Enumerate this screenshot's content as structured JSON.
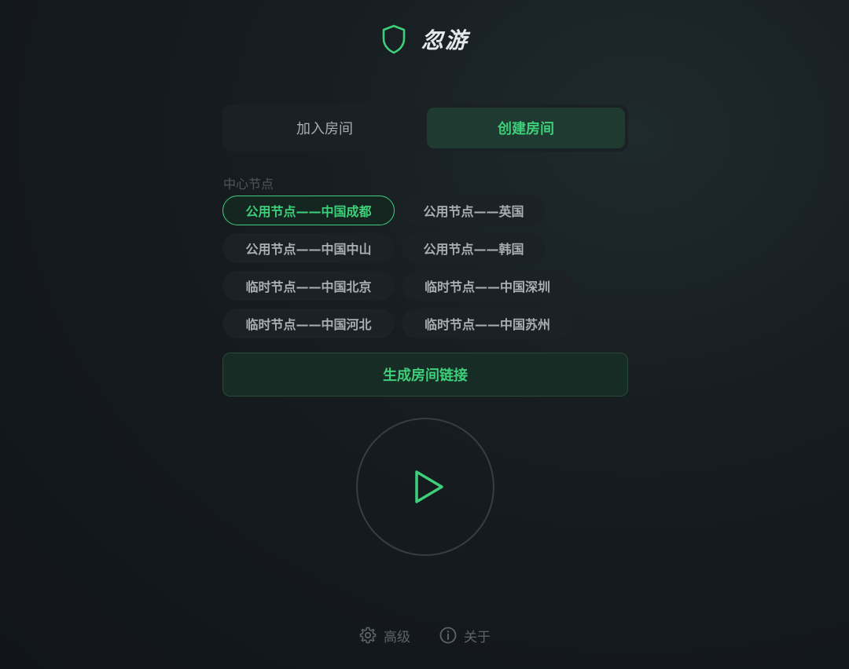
{
  "app": {
    "title": "忽游",
    "icon": "shield-icon",
    "accent": "#3ecf7a"
  },
  "tabs": [
    {
      "label": "加入房间",
      "active": false
    },
    {
      "label": "创建房间",
      "active": true
    }
  ],
  "nodes": {
    "label": "中心节点",
    "items": [
      {
        "label": "公用节点——中国成都",
        "selected": true
      },
      {
        "label": "公用节点——英国",
        "selected": false
      },
      {
        "label": "公用节点——中国中山",
        "selected": false
      },
      {
        "label": "公用节点——韩国",
        "selected": false
      },
      {
        "label": "临时节点——中国北京",
        "selected": false
      },
      {
        "label": "临时节点——中国深圳",
        "selected": false
      },
      {
        "label": "临时节点——中国河北",
        "selected": false
      },
      {
        "label": "临时节点——中国苏州",
        "selected": false
      }
    ]
  },
  "actions": {
    "generate_label": "生成房间链接",
    "play_icon": "play-icon"
  },
  "footer": {
    "advanced_label": "高级",
    "advanced_icon": "gear-icon",
    "about_label": "关于",
    "about_icon": "info-icon"
  }
}
